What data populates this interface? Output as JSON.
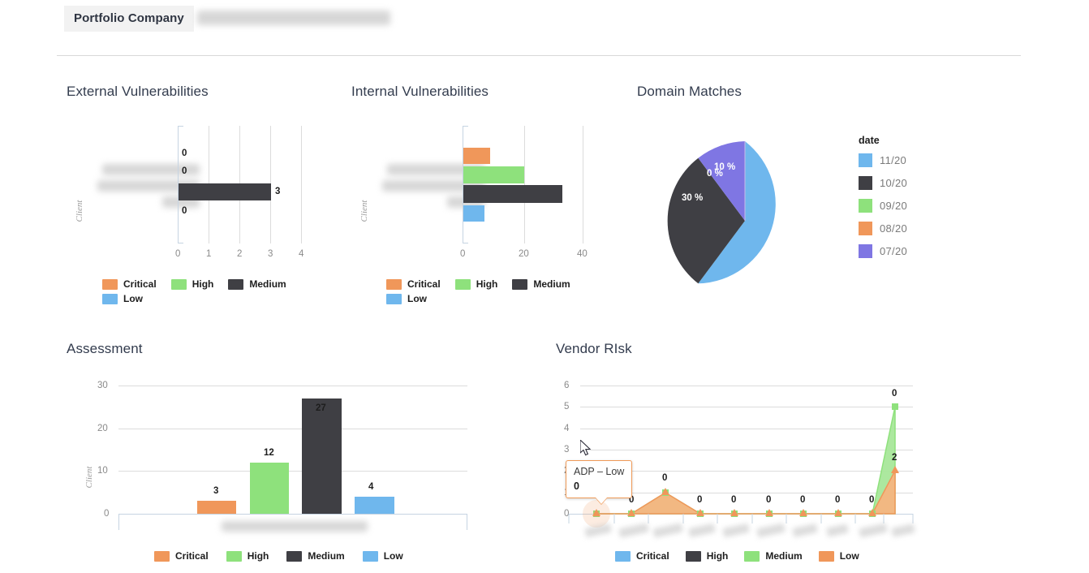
{
  "header": {
    "tab_label": "Portfolio Company",
    "company_name_redacted": ""
  },
  "colors": {
    "critical": "#f0975a",
    "high": "#8ee17c",
    "medium": "#3f3f44",
    "low": "#6fb7ed",
    "purple": "#7f76e3",
    "grid": "#dcdcdc",
    "axis": "#c6d4e2"
  },
  "panels": {
    "external": {
      "title": "External Vulnerabilities",
      "axis_label": "Client"
    },
    "internal": {
      "title": "Internal Vulnerabilities",
      "axis_label": "Client"
    },
    "domain": {
      "title": "Domain Matches",
      "legend_title": "date"
    },
    "assessment": {
      "title": "Assessment",
      "axis_label": "Client"
    },
    "vendor": {
      "title": "Vendor RIsk"
    }
  },
  "legend_severity": [
    {
      "label": "Critical",
      "color": "#f0975a"
    },
    {
      "label": "High",
      "color": "#8ee17c"
    },
    {
      "label": "Medium",
      "color": "#3f3f44"
    },
    {
      "label": "Low",
      "color": "#6fb7ed"
    }
  ],
  "legend_vendor": [
    {
      "label": "Critical",
      "color": "#6fb7ed"
    },
    {
      "label": "High",
      "color": "#3f3f44"
    },
    {
      "label": "Medium",
      "color": "#8ee17c"
    },
    {
      "label": "Low",
      "color": "#f0975a"
    }
  ],
  "tooltip": {
    "title": "ADP – Low",
    "value": "0"
  },
  "chart_data": [
    {
      "id": "external_vulnerabilities",
      "type": "bar",
      "orientation": "horizontal",
      "title": "External Vulnerabilities",
      "ylabel": "Client",
      "xlabel": "",
      "categories": [
        "Critical",
        "High",
        "Medium",
        "Low"
      ],
      "values": [
        0,
        0,
        3,
        0
      ],
      "data_labels": [
        "0",
        "0",
        "3",
        "0"
      ],
      "xlim": [
        0,
        4
      ],
      "xticks": [
        "0",
        "1",
        "2",
        "3",
        "4"
      ],
      "colors": [
        "#f0975a",
        "#8ee17c",
        "#3f3f44",
        "#6fb7ed"
      ],
      "grid": true,
      "legend_position": "bottom"
    },
    {
      "id": "internal_vulnerabilities",
      "type": "bar",
      "orientation": "horizontal",
      "title": "Internal Vulnerabilities",
      "ylabel": "Client",
      "xlabel": "",
      "categories": [
        "Critical",
        "High",
        "Medium",
        "Low"
      ],
      "values": [
        9,
        20,
        33,
        7
      ],
      "data_labels": [],
      "xlim": [
        0,
        40
      ],
      "xticks": [
        "0",
        "20",
        "40"
      ],
      "colors": [
        "#f0975a",
        "#8ee17c",
        "#3f3f44",
        "#6fb7ed"
      ],
      "grid": true,
      "legend_position": "bottom"
    },
    {
      "id": "domain_matches",
      "type": "pie",
      "title": "Domain Matches",
      "legend_title": "date",
      "categories": [
        "11/20",
        "10/20",
        "09/20",
        "08/20",
        "07/20"
      ],
      "values": [
        60,
        30,
        0,
        0,
        10
      ],
      "slice_labels": [
        "60 %",
        "30 %",
        "0 %",
        "",
        "10 %"
      ],
      "colors": [
        "#6fb7ed",
        "#3f3f44",
        "#8ee17c",
        "#f0975a",
        "#7f76e3"
      ],
      "legend_position": "right"
    },
    {
      "id": "assessment",
      "type": "bar",
      "orientation": "vertical",
      "title": "Assessment",
      "ylabel": "Client",
      "categories": [
        "Critical",
        "High",
        "Medium",
        "Low"
      ],
      "values": [
        3,
        12,
        27,
        4
      ],
      "data_labels": [
        "3",
        "12",
        "27",
        "4"
      ],
      "ylim": [
        0,
        30
      ],
      "yticks": [
        "0",
        "10",
        "20",
        "30"
      ],
      "colors": [
        "#f0975a",
        "#8ee17c",
        "#3f3f44",
        "#6fb7ed"
      ],
      "grid": true,
      "legend_position": "bottom"
    },
    {
      "id": "vendor_risk",
      "type": "area",
      "title": "Vendor RIsk",
      "x": [
        "",
        "",
        "",
        "",
        "",
        "",
        "",
        "",
        "",
        ""
      ],
      "ylim": [
        0,
        6
      ],
      "yticks": [
        "0",
        "1",
        "2",
        "3",
        "4",
        "5",
        "6"
      ],
      "series": [
        {
          "name": "Critical",
          "color": "#6fb7ed",
          "values": [
            0,
            0,
            0,
            0,
            0,
            0,
            0,
            0,
            0,
            0
          ]
        },
        {
          "name": "High",
          "color": "#3f3f44",
          "values": [
            0,
            0,
            0,
            0,
            0,
            0,
            0,
            0,
            0,
            0
          ]
        },
        {
          "name": "Medium",
          "color": "#8ee17c",
          "values": [
            0,
            0,
            1,
            0,
            0,
            0,
            0,
            0,
            0,
            5
          ]
        },
        {
          "name": "Low",
          "color": "#f0975a",
          "values": [
            0,
            0,
            1,
            0,
            0,
            0,
            0,
            0,
            0,
            2
          ]
        }
      ],
      "point_labels": [
        "0",
        "0",
        "0",
        "0",
        "0",
        "0",
        "0",
        "0",
        "0",
        "0"
      ],
      "extra_labels": [
        {
          "text": "0",
          "x_index": 9,
          "value": 5
        },
        {
          "text": "2",
          "x_index": 9,
          "value": 2
        }
      ],
      "grid": true,
      "legend_position": "bottom"
    }
  ]
}
